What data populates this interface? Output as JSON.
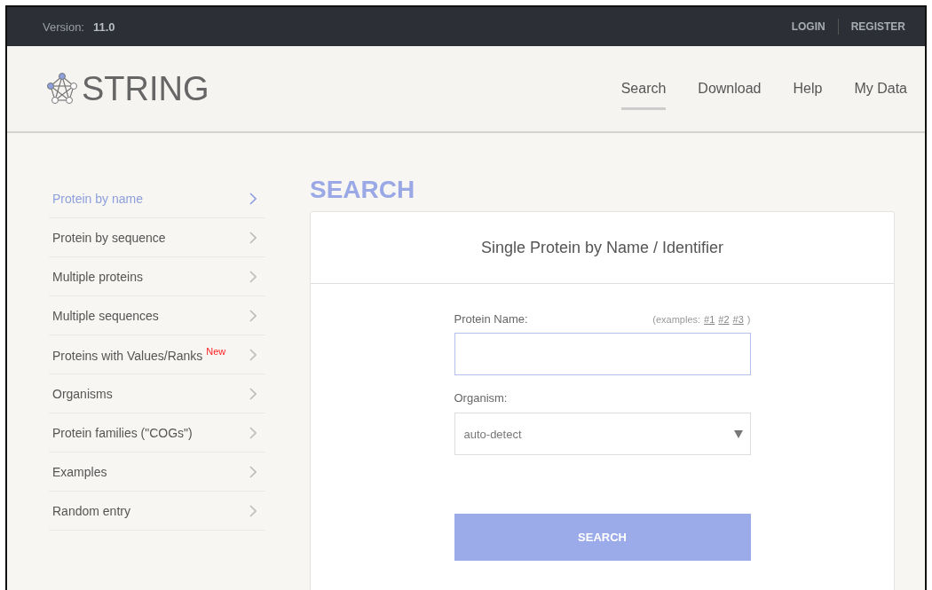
{
  "top_bar": {
    "version_label": "Version:",
    "version": "11.0",
    "links": [
      "LOGIN",
      "REGISTER"
    ]
  },
  "header": {
    "logo_text": "STRING",
    "nav": [
      {
        "label": "Search",
        "selected": true
      },
      {
        "label": "Download",
        "selected": false
      },
      {
        "label": "Help",
        "selected": false
      },
      {
        "label": "My Data",
        "selected": false
      }
    ]
  },
  "sidebar": {
    "items": [
      {
        "label": "Protein by name",
        "selected": true
      },
      {
        "label": "Protein by sequence",
        "selected": false
      },
      {
        "label": "Multiple proteins",
        "selected": false
      },
      {
        "label": "Multiple sequences",
        "selected": false
      },
      {
        "label": "Proteins with Values/Ranks $^{New}$",
        "selected": false
      },
      {
        "label": "Organisms",
        "selected": false
      },
      {
        "label": "Protein families (\"COGs\")",
        "selected": false
      },
      {
        "label": "Examples",
        "selected": false
      },
      {
        "label": "Random entry",
        "selected": false
      }
    ]
  },
  "main": {
    "heading": "SEARCH",
    "card_title": "Single Protein by Name / Identifier",
    "protein_name": {
      "label": "Protein Name:",
      "examples_prefix": "(examples:",
      "examples": [
        "#1",
        "#2",
        "#3"
      ],
      "examples_suffix": ")"
    },
    "organism": {
      "label": "Organism:",
      "value": "auto-detect"
    },
    "search_button": "SEARCH"
  }
}
